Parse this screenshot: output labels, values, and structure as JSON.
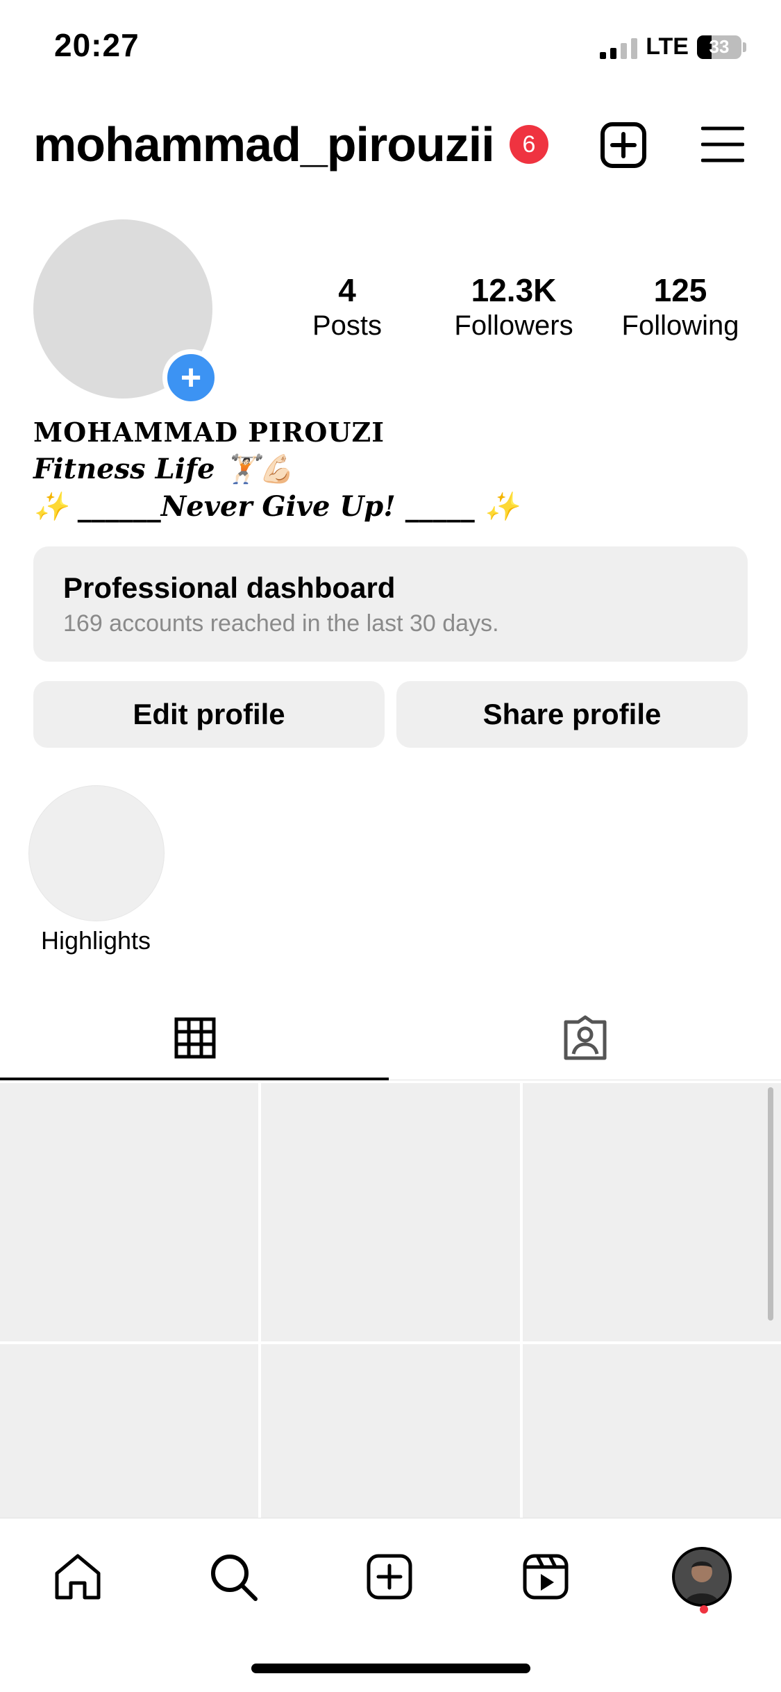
{
  "status_bar": {
    "time": "20:27",
    "network": "LTE",
    "battery": "33"
  },
  "header": {
    "username": "mohammad_pirouzii",
    "notification_count": "6"
  },
  "profile": {
    "stats": [
      {
        "value": "4",
        "label": "Posts"
      },
      {
        "value": "12.3K",
        "label": "Followers"
      },
      {
        "value": "125",
        "label": "Following"
      }
    ],
    "full_name": "MOHAMMAD PIROUZI",
    "bio_line1": "Fitness Life 🏋🏻💪🏻",
    "bio_line2": "✨ ______Never Give Up! _____ ✨"
  },
  "dashboard": {
    "title": "Professional dashboard",
    "subtitle": "169 accounts reached in the last 30 days."
  },
  "actions": {
    "edit_profile": "Edit profile",
    "share_profile": "Share profile"
  },
  "highlights": {
    "label": "Highlights"
  },
  "tabs": [
    {
      "icon": "grid-icon",
      "active": true
    },
    {
      "icon": "tagged-person-icon",
      "active": false
    }
  ],
  "bottom_nav": [
    "home-icon",
    "search-icon",
    "create-icon",
    "reels-icon",
    "profile-avatar"
  ],
  "colors": {
    "badge": "#ef3340",
    "add_button": "#3c93f3",
    "card": "#efefef"
  }
}
